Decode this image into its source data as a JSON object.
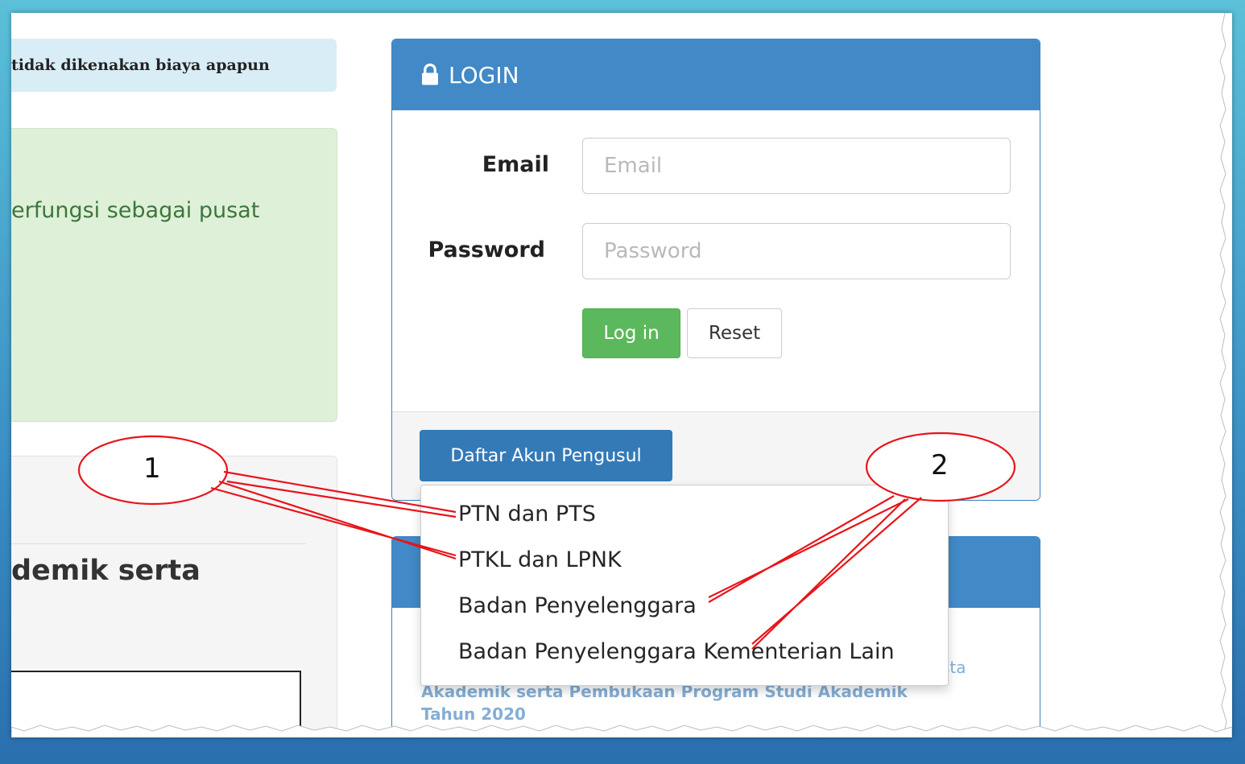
{
  "left": {
    "notice_blue": "tidak dikenakan biaya apapun",
    "notice_green": "erfungsi sebagai pusat",
    "section_heading": "demik serta"
  },
  "login": {
    "title": "LOGIN",
    "email_label": "Email",
    "email_placeholder": "Email",
    "password_label": "Password",
    "password_placeholder": "Password",
    "login_button": "Log in",
    "reset_button": "Reset",
    "register_button": "Daftar Akun Pengusul"
  },
  "dropdown": {
    "items": [
      "PTN dan PTS",
      "PTKL dan LPNK",
      "Badan Penyelenggara",
      "Badan Penyelenggara Kementerian Lain"
    ]
  },
  "news": {
    "tail": "sta",
    "line1": "Akademik serta Pembukaan Program Studi Akademik",
    "line2": "Tahun 2020"
  },
  "annotations": {
    "label_1": "1",
    "label_2": "2"
  },
  "colors": {
    "panel_header": "#4189c7",
    "login_button": "#5cb85c",
    "register_button": "#337ab7",
    "annotation": "#e8141a"
  }
}
